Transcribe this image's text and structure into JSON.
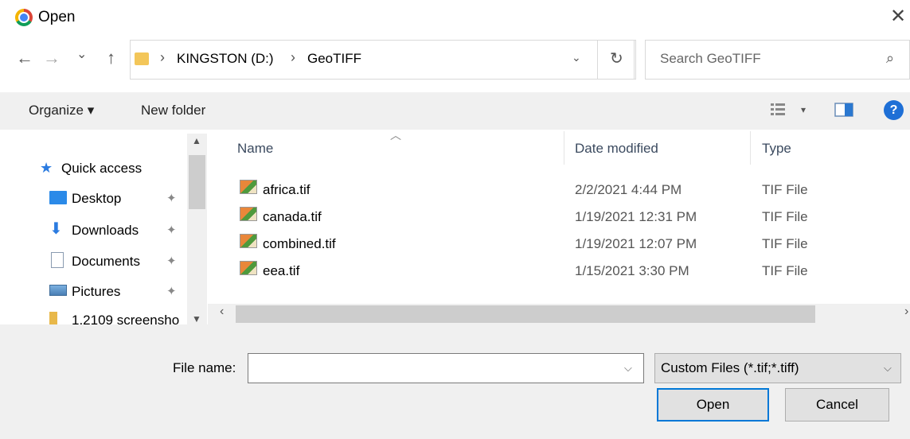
{
  "window": {
    "title": "Open",
    "close_glyph": "✕",
    "app_icon": "chrome-icon"
  },
  "nav": {
    "back": "←",
    "forward": "→",
    "recent": "⌄",
    "up": "↑"
  },
  "address": {
    "sep": "›",
    "crumbs": [
      "KINGSTON (D:)",
      "GeoTIFF"
    ],
    "dropdown": "⌄",
    "refresh": "↻"
  },
  "search": {
    "placeholder": "Search GeoTIFF",
    "icon": "⌕"
  },
  "toolbar": {
    "organize": "Organize ▾",
    "new_folder": "New folder",
    "view_dd": "▾",
    "help": "?"
  },
  "sidebar": {
    "items": [
      {
        "label": "Quick access",
        "icon": "star-icon"
      },
      {
        "label": "Desktop",
        "icon": "desktop-icon",
        "pinned": true
      },
      {
        "label": "Downloads",
        "icon": "downloads-icon",
        "pinned": true
      },
      {
        "label": "Documents",
        "icon": "documents-icon",
        "pinned": true
      },
      {
        "label": "Pictures",
        "icon": "pictures-icon",
        "pinned": true
      },
      {
        "label": "1.2109 screensho",
        "icon": "folder-icon"
      }
    ],
    "pin_glyph": "📌"
  },
  "file_list": {
    "columns": [
      "Name",
      "Date modified",
      "Type"
    ],
    "rows": [
      {
        "name": "africa.tif",
        "date": "2/2/2021 4:44 PM",
        "type": "TIF File"
      },
      {
        "name": "canada.tif",
        "date": "1/19/2021 12:31 PM",
        "type": "TIF File"
      },
      {
        "name": "combined.tif",
        "date": "1/19/2021 12:07 PM",
        "type": "TIF File"
      },
      {
        "name": "eea.tif",
        "date": "1/15/2021 3:30 PM",
        "type": "TIF File"
      }
    ]
  },
  "bottom": {
    "file_name_label": "File name:",
    "file_name_value": "",
    "filter": "Custom Files (*.tif;*.tiff)",
    "open": "Open",
    "cancel": "Cancel"
  },
  "colors": {
    "accent": "#0078d7",
    "panel": "#f0f0f0",
    "help": "#1e6fd6"
  }
}
